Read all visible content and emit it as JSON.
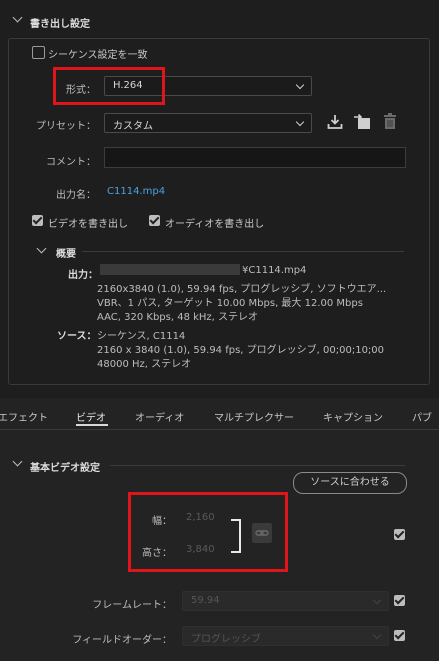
{
  "export": {
    "section_title": "書き出し設定",
    "match_sequence_label": "シーケンス設定を一致",
    "match_sequence_checked": false,
    "format_label": "形式：",
    "format_value": "H.264",
    "preset_label": "プリセット：",
    "preset_value": "カスタム",
    "comment_label": "コメント：",
    "comment_value": "",
    "output_name_label": "出力名：",
    "output_name_value": "C1114.mp4",
    "export_video_label": "ビデオを書き出し",
    "export_video_checked": true,
    "export_audio_label": "オーディオを書き出し",
    "export_audio_checked": true
  },
  "summary": {
    "title": "概要",
    "output_label": "出力：",
    "output_line1": "¥C1114.mp4",
    "output_line2": "2160x3840 (1.0), 59.94 fps, プログレッシブ, ソフトウエア...",
    "output_line3": "VBR、1 パス, ターゲット 10.00 Mbps, 最大 12.00 Mbps",
    "output_line4": "AAC, 320 Kbps, 48 kHz, ステレオ",
    "source_label": "ソース：",
    "source_line1": "シーケンス, C1114",
    "source_line2": "2160 x 3840 (1.0), 59.94 fps, プログレッシブ, 00;00;10;00",
    "source_line3": "48000  Hz, ステレオ"
  },
  "tabs": [
    {
      "label": "エフェクト",
      "active": false
    },
    {
      "label": "ビデオ",
      "active": true
    },
    {
      "label": "オーディオ",
      "active": false
    },
    {
      "label": "マルチプレクサー",
      "active": false
    },
    {
      "label": "キャプション",
      "active": false
    },
    {
      "label": "パブ",
      "active": false
    }
  ],
  "video": {
    "section_title": "基本ビデオ設定",
    "match_source_button": "ソースに合わせる",
    "width_label": "幅：",
    "width_value": "2,160",
    "height_label": "高さ：",
    "height_value": "3,840",
    "dimensions_checked": true,
    "framerate_label": "フレームレート：",
    "framerate_value": "59.94",
    "framerate_checked": true,
    "field_order_label": "フィールドオーダー：",
    "field_order_value": "プログレッシブ",
    "field_order_checked": true
  },
  "colors": {
    "highlight": "#e0151b",
    "link": "#4aa3df"
  }
}
